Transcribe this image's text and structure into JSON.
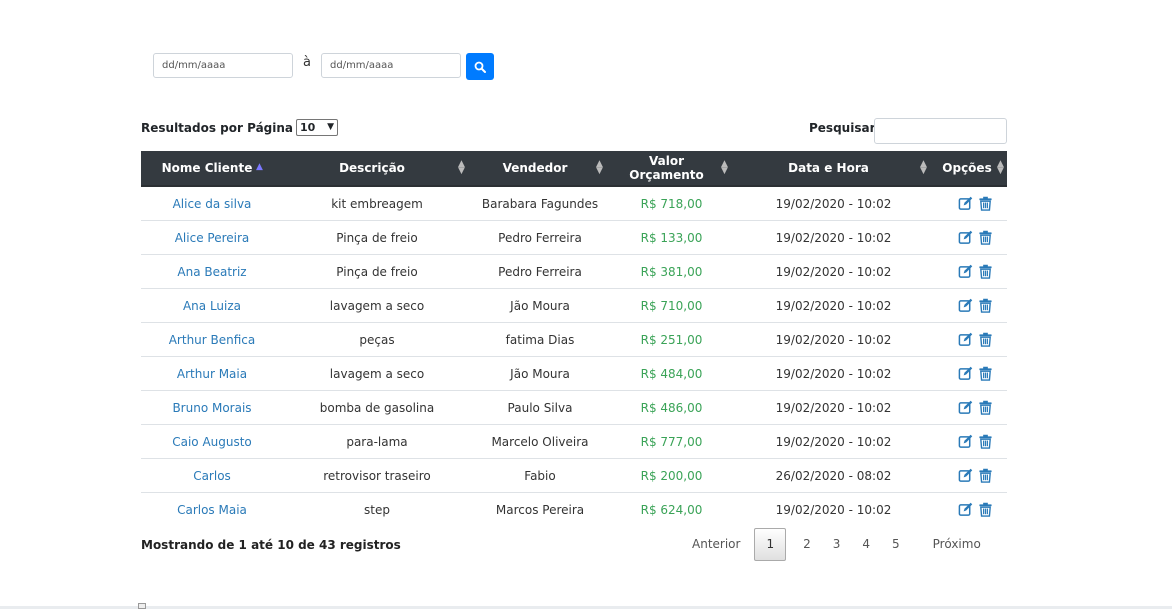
{
  "filters": {
    "date_from_placeholder": "dd/mm/aaaa",
    "date_to_placeholder": "dd/mm/aaaa",
    "separator": "à",
    "search_icon": "magnifier-icon"
  },
  "length_menu": {
    "label": "Resultados por Página",
    "selected": "10"
  },
  "search": {
    "label": "Pesquisar",
    "value": ""
  },
  "table": {
    "columns": [
      "Nome Cliente",
      "Descrição",
      "Vendedor",
      "Valor Orçamento",
      "Data e Hora",
      "Opções"
    ],
    "rows": [
      {
        "client": "Alice da silva",
        "description": "kit embreagem",
        "seller": "Barabara Fagundes",
        "value": "R$ 718,00",
        "datetime": "19/02/2020 - 10:02"
      },
      {
        "client": "Alice Pereira",
        "description": "Pinça de freio",
        "seller": "Pedro Ferreira",
        "value": "R$ 133,00",
        "datetime": "19/02/2020 - 10:02"
      },
      {
        "client": "Ana Beatriz",
        "description": "Pinça de freio",
        "seller": "Pedro Ferreira",
        "value": "R$ 381,00",
        "datetime": "19/02/2020 - 10:02"
      },
      {
        "client": "Ana Luiza",
        "description": "lavagem a seco",
        "seller": "Jão Moura",
        "value": "R$ 710,00",
        "datetime": "19/02/2020 - 10:02"
      },
      {
        "client": "Arthur Benfica",
        "description": "peças",
        "seller": "fatima Dias",
        "value": "R$ 251,00",
        "datetime": "19/02/2020 - 10:02"
      },
      {
        "client": "Arthur Maia",
        "description": "lavagem a seco",
        "seller": "Jão Moura",
        "value": "R$ 484,00",
        "datetime": "19/02/2020 - 10:02"
      },
      {
        "client": "Bruno Morais",
        "description": "bomba de gasolina",
        "seller": "Paulo Silva",
        "value": "R$ 486,00",
        "datetime": "19/02/2020 - 10:02"
      },
      {
        "client": "Caio Augusto",
        "description": "para-lama",
        "seller": "Marcelo Oliveira",
        "value": "R$ 777,00",
        "datetime": "19/02/2020 - 10:02"
      },
      {
        "client": "Carlos",
        "description": "retrovisor traseiro",
        "seller": "Fabio",
        "value": "R$ 200,00",
        "datetime": "26/02/2020 - 08:02"
      },
      {
        "client": "Carlos Maia",
        "description": "step",
        "seller": "Marcos Pereira",
        "value": "R$ 624,00",
        "datetime": "19/02/2020 - 10:02"
      }
    ]
  },
  "info": "Mostrando de 1 até 10 de 43 registros",
  "pagination": {
    "previous": "Anterior",
    "pages": [
      "1",
      "2",
      "3",
      "4",
      "5"
    ],
    "current": "1",
    "next": "Próximo"
  },
  "colors": {
    "header_bg": "#343a40",
    "link": "#2a7ab8",
    "value": "#3aa357",
    "primary": "#007bff"
  }
}
